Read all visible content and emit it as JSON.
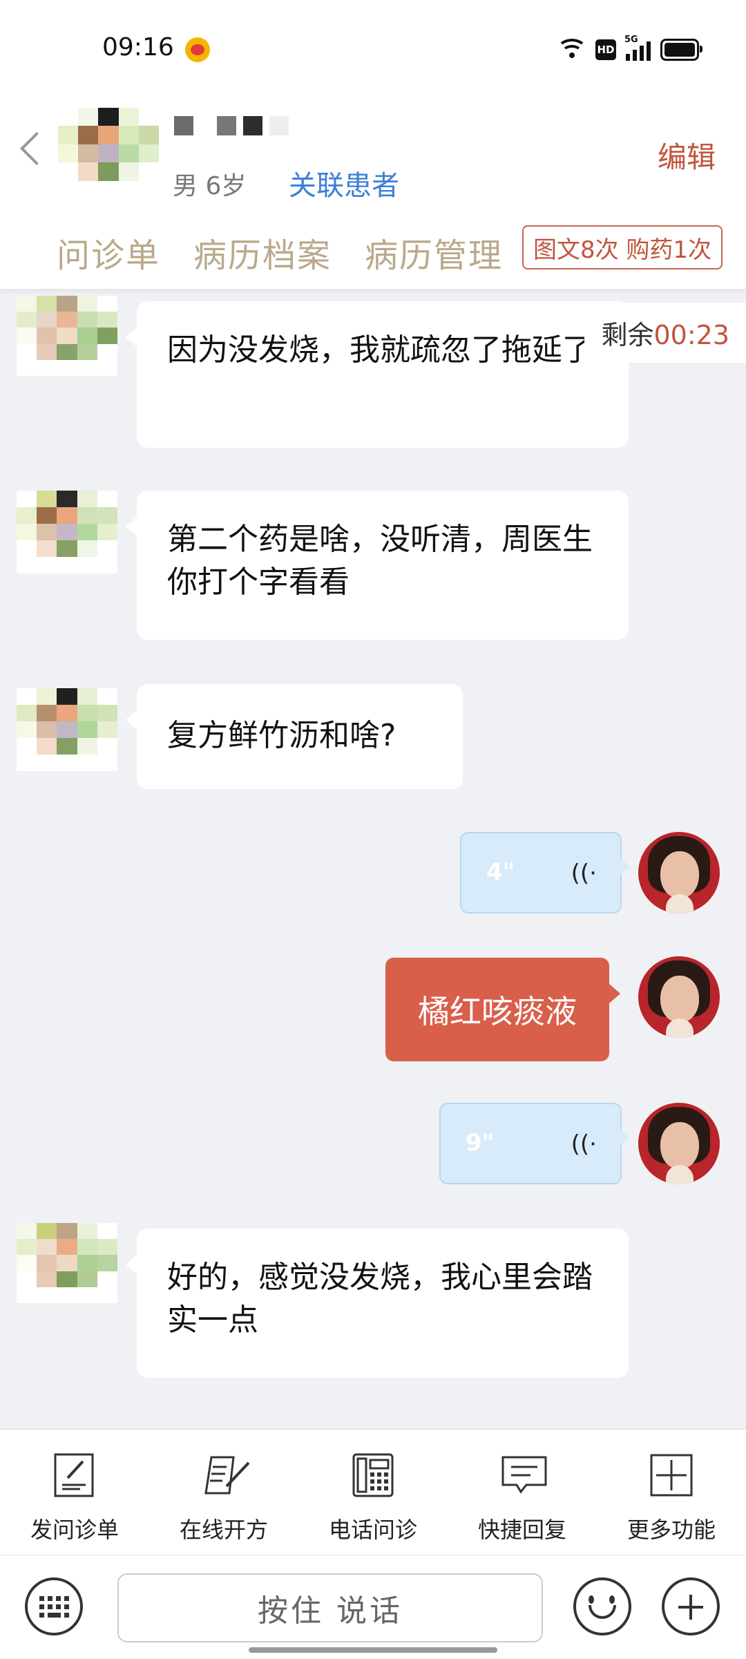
{
  "status_bar": {
    "time": "09:16",
    "hd_label": "HD",
    "network_label": "5G"
  },
  "header": {
    "patient_meta": "男 6岁",
    "link_patient": "关联患者",
    "edit": "编辑",
    "tabs": [
      "问诊单",
      "病历档案",
      "病历管理"
    ],
    "counts": "图文8次 购药1次"
  },
  "timer": {
    "label": "剩余",
    "value": "00:23"
  },
  "messages": [
    {
      "from": "patient",
      "type": "text",
      "text": "因为没发烧，我就疏忽了拖延了"
    },
    {
      "from": "patient",
      "type": "text",
      "text": "第二个药是啥，没听清，周医生你打个字看看"
    },
    {
      "from": "patient",
      "type": "text",
      "text": "复方鲜竹沥和啥?"
    },
    {
      "from": "doctor",
      "type": "voice",
      "duration": "4\""
    },
    {
      "from": "doctor",
      "type": "text",
      "text": "橘红咳痰液"
    },
    {
      "from": "doctor",
      "type": "voice",
      "duration": "9\""
    },
    {
      "from": "patient",
      "type": "text",
      "text": "好的，感觉没发烧，我心里会踏实一点"
    }
  ],
  "toolbar": {
    "items": [
      {
        "label": "发问诊单",
        "icon": "form-icon"
      },
      {
        "label": "在线开方",
        "icon": "prescription-icon"
      },
      {
        "label": "电话问诊",
        "icon": "phone-icon"
      },
      {
        "label": "快捷回复",
        "icon": "quick-reply-icon"
      },
      {
        "label": "更多功能",
        "icon": "more-icon"
      }
    ]
  },
  "input_bar": {
    "hold_to_talk": "按住 说话"
  },
  "colors": {
    "accent": "#c1553d",
    "link": "#3d7fd6",
    "tab": "#b9a98a",
    "voice_bubble": "#d7ebfb",
    "sent_bubble": "#d85f4a"
  }
}
